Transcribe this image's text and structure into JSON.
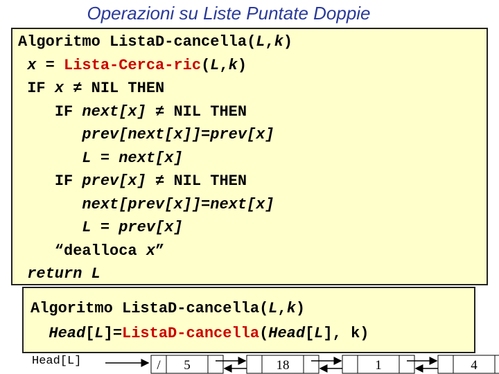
{
  "title": "Operazioni su Liste Puntate Doppie",
  "algo1": {
    "lines": [
      {
        "indent": "",
        "parts": [
          {
            "t": "Algoritmo Lista",
            "s": ""
          },
          {
            "t": "D",
            "s": ""
          },
          {
            "t": "-cancella(",
            "s": ""
          },
          {
            "t": "L",
            "s": "it"
          },
          {
            "t": ",",
            "s": ""
          },
          {
            "t": "k",
            "s": "it"
          },
          {
            "t": ")",
            "s": ""
          }
        ]
      },
      {
        "indent": " ",
        "parts": [
          {
            "t": "x",
            "s": "it"
          },
          {
            "t": " = ",
            "s": ""
          },
          {
            "t": "Lista-Cerca-ric",
            "s": "red"
          },
          {
            "t": "(",
            "s": ""
          },
          {
            "t": "L",
            "s": "it"
          },
          {
            "t": ",",
            "s": ""
          },
          {
            "t": "k",
            "s": "it"
          },
          {
            "t": ")",
            "s": ""
          }
        ]
      },
      {
        "indent": " ",
        "parts": [
          {
            "t": "IF ",
            "s": ""
          },
          {
            "t": "x",
            "s": "it"
          },
          {
            "t": " ≠ NIL THEN",
            "s": ""
          }
        ]
      },
      {
        "indent": "    ",
        "parts": [
          {
            "t": "IF ",
            "s": ""
          },
          {
            "t": "next[x]",
            "s": "it"
          },
          {
            "t": " ≠ NIL THEN",
            "s": ""
          }
        ]
      },
      {
        "indent": "       ",
        "parts": [
          {
            "t": "prev[next[x]]=prev[x]",
            "s": "it"
          }
        ]
      },
      {
        "indent": "       ",
        "parts": [
          {
            "t": "L = next[x]",
            "s": "it"
          }
        ]
      },
      {
        "indent": "    ",
        "parts": [
          {
            "t": "IF ",
            "s": ""
          },
          {
            "t": "prev[x]",
            "s": "it"
          },
          {
            "t": " ≠ NIL THEN",
            "s": ""
          }
        ]
      },
      {
        "indent": "       ",
        "parts": [
          {
            "t": "next[prev[x]]=next[x]",
            "s": "it"
          }
        ]
      },
      {
        "indent": "       ",
        "parts": [
          {
            "t": "L = prev[x]",
            "s": "it"
          }
        ]
      },
      {
        "indent": "    ",
        "parts": [
          {
            "t": "“dealloca ",
            "s": ""
          },
          {
            "t": "x",
            "s": "it"
          },
          {
            "t": "”",
            "s": ""
          }
        ]
      },
      {
        "indent": " ",
        "parts": [
          {
            "t": "return L",
            "s": "it"
          }
        ]
      }
    ]
  },
  "algo2": {
    "lines": [
      {
        "indent": "",
        "parts": [
          {
            "t": "Algoritmo Lista",
            "s": ""
          },
          {
            "t": "D",
            "s": ""
          },
          {
            "t": "-cancella(",
            "s": ""
          },
          {
            "t": "L",
            "s": "it"
          },
          {
            "t": ",",
            "s": ""
          },
          {
            "t": "k",
            "s": "it"
          },
          {
            "t": ")",
            "s": ""
          }
        ]
      },
      {
        "indent": "  ",
        "parts": [
          {
            "t": "Head",
            "s": "it"
          },
          {
            "t": "[",
            "s": ""
          },
          {
            "t": "L",
            "s": "it"
          },
          {
            "t": "]=",
            "s": ""
          },
          {
            "t": "ListaD-cancella",
            "s": "red"
          },
          {
            "t": "(",
            "s": ""
          },
          {
            "t": "Head",
            "s": "it"
          },
          {
            "t": "[",
            "s": ""
          },
          {
            "t": "L",
            "s": "it"
          },
          {
            "t": "], k)",
            "s": ""
          }
        ]
      }
    ]
  },
  "list": {
    "head_label": "Head[L]",
    "nodes": [
      {
        "prev": "/",
        "key": "5",
        "next": ""
      },
      {
        "prev": "",
        "key": "18",
        "next": ""
      },
      {
        "prev": "",
        "key": "1",
        "next": ""
      },
      {
        "prev": "",
        "key": "4",
        "next": "/"
      }
    ]
  },
  "colors": {
    "title": "#2a3a9a",
    "box": "#ffffcc",
    "keyword": "#cc0000"
  }
}
